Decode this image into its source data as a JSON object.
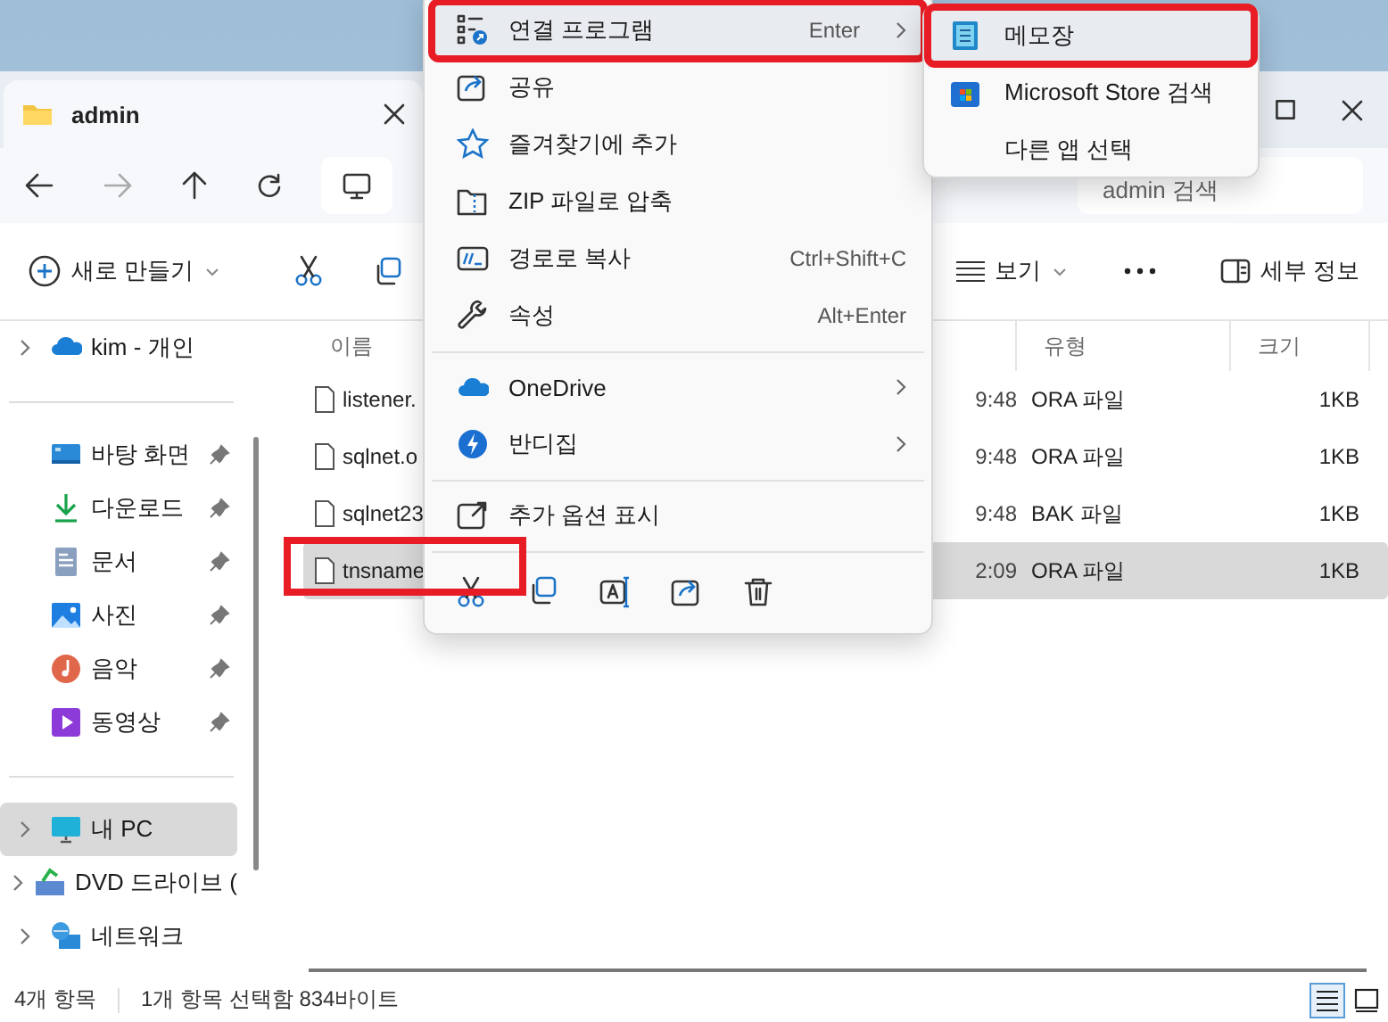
{
  "window": {
    "tab_title": "admin"
  },
  "address_bar": {
    "search_placeholder": "admin 검색"
  },
  "toolbar": {
    "new_label": "새로 만들기",
    "view_label": "보기",
    "details_label": "세부 정보"
  },
  "sidebar": {
    "sections": [
      {
        "items": [
          {
            "label": "kim - 개인",
            "kind": "onedrive",
            "expandable": true,
            "pinned": false,
            "selected": false
          }
        ]
      },
      {
        "items": [
          {
            "label": "바탕 화면",
            "kind": "desktop",
            "expandable": false,
            "pinned": true,
            "selected": false
          },
          {
            "label": "다운로드",
            "kind": "download",
            "expandable": false,
            "pinned": true,
            "selected": false
          },
          {
            "label": "문서",
            "kind": "documents",
            "expandable": false,
            "pinned": true,
            "selected": false
          },
          {
            "label": "사진",
            "kind": "pictures",
            "expandable": false,
            "pinned": true,
            "selected": false
          },
          {
            "label": "음악",
            "kind": "music",
            "expandable": false,
            "pinned": true,
            "selected": false
          },
          {
            "label": "동영상",
            "kind": "videos",
            "expandable": false,
            "pinned": true,
            "selected": false
          }
        ]
      },
      {
        "items": [
          {
            "label": "내 PC",
            "kind": "pc",
            "expandable": true,
            "pinned": false,
            "selected": true
          },
          {
            "label": "DVD 드라이브 (",
            "kind": "dvd",
            "expandable": true,
            "pinned": false,
            "selected": false
          },
          {
            "label": "네트워크",
            "kind": "network",
            "expandable": true,
            "pinned": false,
            "selected": false
          }
        ]
      }
    ]
  },
  "file_list": {
    "columns": [
      "이름",
      "유형",
      "크기"
    ],
    "rows": [
      {
        "name": "listener.",
        "modified": "9:48",
        "type": "ORA 파일",
        "size": "1KB",
        "selected": false,
        "outlined": false
      },
      {
        "name": "sqlnet.o",
        "modified": "9:48",
        "type": "ORA 파일",
        "size": "1KB",
        "selected": false,
        "outlined": false
      },
      {
        "name": "sqlnet23",
        "modified": "9:48",
        "type": "BAK 파일",
        "size": "1KB",
        "selected": false,
        "outlined": false
      },
      {
        "name": "tnsname",
        "modified": "2:09",
        "type": "ORA 파일",
        "size": "1KB",
        "selected": true,
        "outlined": true
      }
    ]
  },
  "context_menu": {
    "groups": [
      {
        "items": [
          {
            "kind": "openwith",
            "label": "연결 프로그램",
            "shortcut": "Enter",
            "submenu": true,
            "selected": true,
            "outlined": true
          },
          {
            "kind": "share",
            "label": "공유",
            "submenu": false,
            "selected": false,
            "outlined": false
          },
          {
            "kind": "favorite",
            "label": "즐겨찾기에 추가",
            "submenu": false,
            "selected": false,
            "outlined": false
          },
          {
            "kind": "zip",
            "label": "ZIP 파일로 압축",
            "submenu": false,
            "selected": false,
            "outlined": false
          },
          {
            "kind": "copypath",
            "label": "경로로 복사",
            "shortcut": "Ctrl+Shift+C",
            "submenu": false,
            "selected": false,
            "outlined": false
          },
          {
            "kind": "properties",
            "label": "속성",
            "shortcut": "Alt+Enter",
            "submenu": false,
            "selected": false,
            "outlined": false
          }
        ]
      },
      {
        "items": [
          {
            "kind": "onedrive",
            "label": "OneDrive",
            "submenu": true,
            "selected": false,
            "outlined": false
          },
          {
            "kind": "bandizip",
            "label": "반디집",
            "submenu": true,
            "selected": false,
            "outlined": false
          }
        ]
      },
      {
        "items": [
          {
            "kind": "moreoptions",
            "label": "추가 옵션 표시",
            "submenu": false,
            "selected": false,
            "outlined": false
          }
        ]
      }
    ],
    "actions": [
      {
        "kind": "cut"
      },
      {
        "kind": "copy"
      },
      {
        "kind": "rename"
      },
      {
        "kind": "share"
      },
      {
        "kind": "delete"
      }
    ]
  },
  "submenu": {
    "items": [
      {
        "kind": "notepad",
        "label": "메모장",
        "selected": true,
        "outlined": true
      },
      {
        "kind": "store",
        "label": "Microsoft Store 검색",
        "selected": false,
        "outlined": false
      },
      {
        "kind": "other",
        "label": "다른 앱 선택",
        "selected": false,
        "outlined": false
      }
    ]
  },
  "status_bar": {
    "item_count": "4개 항목",
    "selection": "1개 항목 선택함 834바이트",
    "views": [
      {
        "kind": "details",
        "selected": true
      },
      {
        "kind": "tiles",
        "selected": false
      }
    ]
  }
}
